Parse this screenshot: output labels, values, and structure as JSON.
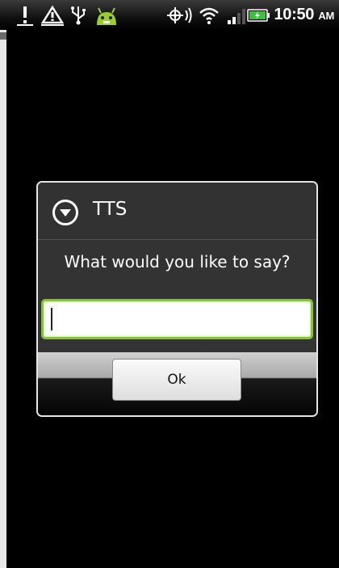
{
  "status_bar": {
    "icons": [
      "alert-icon",
      "warning-triangle-icon",
      "usb-icon",
      "android-robot-icon",
      "gps-icon",
      "wifi-icon",
      "signal-icon",
      "battery-charging-icon"
    ],
    "time": "10:50",
    "ampm": "AM"
  },
  "dialog": {
    "icon": "dropdown-circle-icon",
    "title": "TTS",
    "prompt": "What would you like to say?",
    "input_value": "",
    "ok_label": "Ok"
  }
}
